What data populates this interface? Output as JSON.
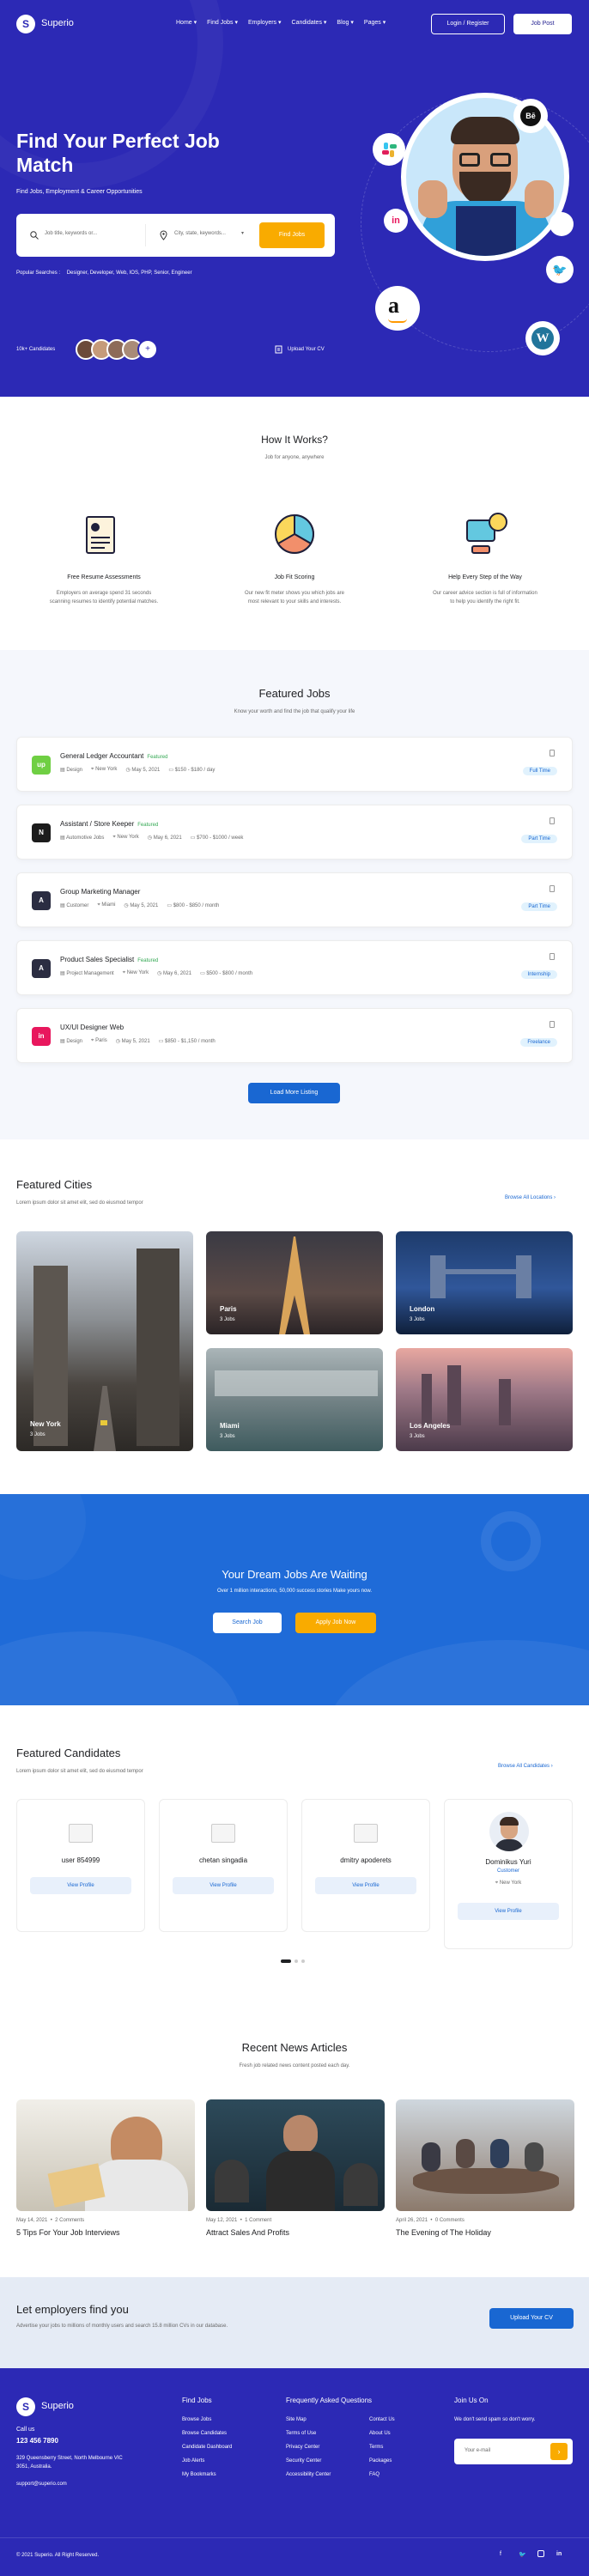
{
  "brand": {
    "name": "Superio"
  },
  "nav": {
    "items": [
      "Home",
      "Find Jobs",
      "Employers",
      "Candidates",
      "Blog",
      "Pages"
    ],
    "login": "Login / Register",
    "post_job": "Job Post"
  },
  "hero": {
    "title_line1": "Find Your Perfect Job",
    "title_line2": "Match",
    "subtitle": "Find Jobs, Employment & Career Opportunities",
    "search_placeholder": "Job title, keywords or...",
    "location_placeholder": "City, state, keywords...",
    "search_button": "Find Jobs",
    "popular_label": "Popular Searches :",
    "popular_terms": "Designer, Developer, Web, IOS, PHP, Senior, Engineer",
    "candidates": "10k+ Candidates",
    "avatars_more": "+",
    "upload_cv": "Upload Your CV"
  },
  "how": {
    "title": "How It Works?",
    "subtitle": "Job for anyone, anywhere",
    "steps": [
      {
        "title": "Free Resume Assessments",
        "desc1": "Employers on average spend 31 seconds",
        "desc2": "scanning resumes to identify potential matches."
      },
      {
        "title": "Job Fit Scoring",
        "desc1": "Our new fit meter shows you which jobs are",
        "desc2": "most relevant to your skills and interests."
      },
      {
        "title": "Help Every Step of the Way",
        "desc1": "Our career advice section is full of information",
        "desc2": "to help you identify the right fit."
      }
    ]
  },
  "featured": {
    "title": "Featured Jobs",
    "subtitle": "Know your worth and find the job that qualify your life",
    "jobs": [
      {
        "title": "General Ledger Accountant",
        "badge": "Featured",
        "cat": "Design",
        "loc": "New York",
        "date": "May 5, 2021",
        "salary": "$150 - $180 / day",
        "type": "Full Time",
        "logo": "up",
        "color": "#6fcf43"
      },
      {
        "title": "Assistant / Store Keeper",
        "badge": "Featured",
        "cat": "Automotive Jobs",
        "loc": "New York",
        "date": "May 6, 2021",
        "salary": "$700 - $1000 / week",
        "type": "Part Time",
        "logo": "N",
        "color": "#1c1c1c"
      },
      {
        "title": "Group Marketing Manager",
        "badge": "",
        "cat": "Customer",
        "loc": "Miami",
        "date": "May 5, 2021",
        "salary": "$800 - $850 / month",
        "type": "Part Time",
        "logo": "A",
        "color": "#2b2d42"
      },
      {
        "title": "Product Sales Specialist",
        "badge": "Featured",
        "cat": "Project Management",
        "loc": "New York",
        "date": "May 6, 2021",
        "salary": "$500 - $800 / month",
        "type": "Internship",
        "logo": "A",
        "color": "#2b2d42"
      },
      {
        "title": "UX/UI Designer Web",
        "badge": "",
        "cat": "Design",
        "loc": "Paris",
        "date": "May 5, 2021",
        "salary": "$850 - $1,150 / month",
        "type": "Freelance",
        "logo": "in",
        "color": "#e8175d"
      }
    ],
    "load_more": "Load More Listing"
  },
  "cities": {
    "title": "Featured Cities",
    "subtitle": "Lorem ipsum dolor sit amet elit, sed do eiusmod tempor",
    "browse": "Browse All Locations",
    "items": [
      {
        "name": "New York",
        "jobs": "3 Jobs"
      },
      {
        "name": "Paris",
        "jobs": "3 Jobs"
      },
      {
        "name": "London",
        "jobs": "3 Jobs"
      },
      {
        "name": "Miami",
        "jobs": "3 Jobs"
      },
      {
        "name": "Los Angeles",
        "jobs": "3 Jobs"
      }
    ]
  },
  "cta": {
    "title": "Your Dream Jobs Are Waiting",
    "subtitle": "Over 1 million interactions, 50,000 success stories Make yours now.",
    "search": "Search Job",
    "apply": "Apply Job Now"
  },
  "candidates": {
    "title": "Featured Candidates",
    "subtitle": "Lorem ipsum dolor sit amet elit, sed do eiusmod tempor",
    "browse": "Browse All Candidates",
    "items": [
      {
        "name": "user 854999",
        "role": "",
        "loc": ""
      },
      {
        "name": "chetan singadia",
        "role": "",
        "loc": ""
      },
      {
        "name": "dmitry apoderets",
        "role": "",
        "loc": ""
      },
      {
        "name": "Dominikus Yuri",
        "role": "Customer",
        "loc": "New York"
      }
    ],
    "view": "View Profile"
  },
  "news": {
    "title": "Recent News Articles",
    "subtitle": "Fresh job related news content posted each day.",
    "items": [
      {
        "date": "May 14, 2021",
        "comments": "2 Comments",
        "title": "5 Tips For Your Job Interviews"
      },
      {
        "date": "May 12, 2021",
        "comments": "1 Comment",
        "title": "Attract Sales And Profits"
      },
      {
        "date": "April 26, 2021",
        "comments": "0 Comments",
        "title": "The Evening of The Holiday"
      }
    ]
  },
  "employers": {
    "title": "Let employers find you",
    "subtitle": "Advertise your jobs to millions of monthly users and search 15.8 million CVs in our database.",
    "button": "Upload Your CV"
  },
  "footer": {
    "call_label": "Call us",
    "phone": "123 456 7890",
    "addr1": "329 Queensberry Street, North Melbourne VIC",
    "addr2": "3051, Australia.",
    "email": "support@superio.com",
    "find_jobs_title": "Find Jobs",
    "find_jobs": [
      "Browse Jobs",
      "Browse Candidates",
      "Candidate Dashboard",
      "Job Alerts",
      "My Bookmarks"
    ],
    "faq_title": "Frequently Asked Questions",
    "faq_col1": [
      "Site Map",
      "Terms of Use",
      "Privacy Center",
      "Security Center",
      "Accessibility Center"
    ],
    "faq_col2": [
      "Contact Us",
      "About Us",
      "Terms",
      "Packages",
      "FAQ"
    ],
    "join_title": "Join Us On",
    "join_text": "We don't send spam so don't worry.",
    "email_placeholder": "Your e-mail",
    "copyright": "© 2021 Superio. All Right Reserved."
  }
}
